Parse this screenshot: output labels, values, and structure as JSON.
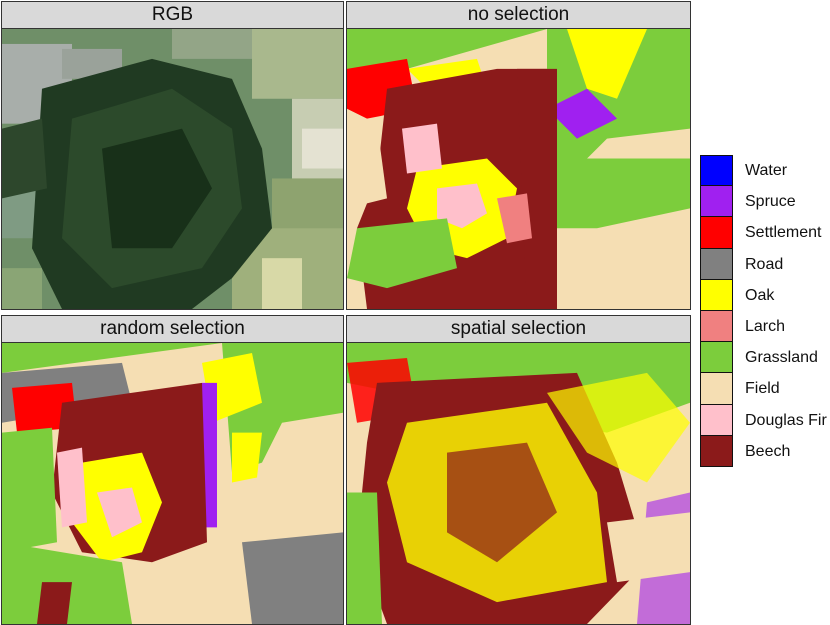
{
  "panels": [
    {
      "title": "RGB"
    },
    {
      "title": "no selection"
    },
    {
      "title": "random selection"
    },
    {
      "title": "spatial selection"
    }
  ],
  "legend": [
    {
      "label": "Water",
      "color": "#0000ff"
    },
    {
      "label": "Spruce",
      "color": "#a020f0"
    },
    {
      "label": "Settlement",
      "color": "#ff0000"
    },
    {
      "label": "Road",
      "color": "#808080"
    },
    {
      "label": "Oak",
      "color": "#ffff00"
    },
    {
      "label": "Larch",
      "color": "#f08080"
    },
    {
      "label": "Grassland",
      "color": "#7ccd3c"
    },
    {
      "label": "Field",
      "color": "#f5deb3"
    },
    {
      "label": "Douglas Fir",
      "color": "#ffc0cb"
    },
    {
      "label": "Beech",
      "color": "#8b1a1a"
    }
  ]
}
